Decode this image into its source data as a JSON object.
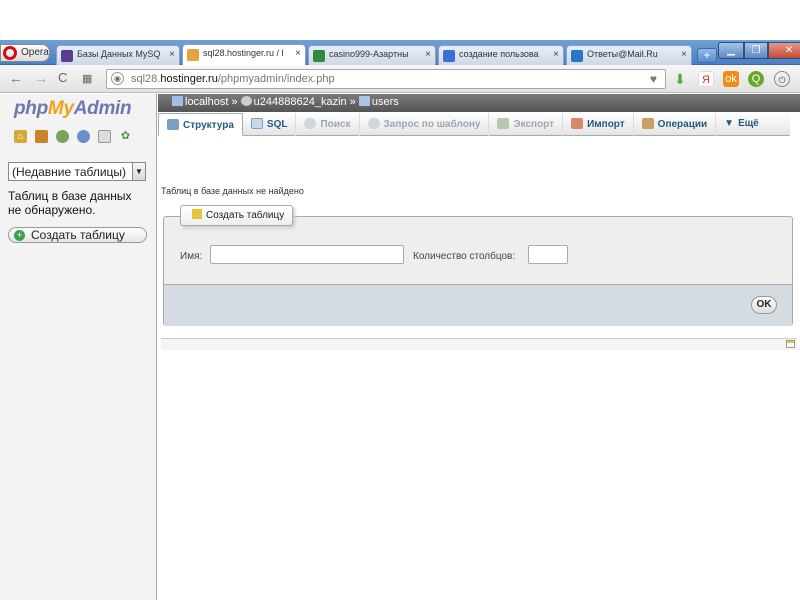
{
  "browser": {
    "opera_label": "Opera",
    "tabs": [
      {
        "label": "Базы Данных MySQ",
        "close": "×",
        "color": "#5a3e8c"
      },
      {
        "label": "sql28.hostinger.ru / l",
        "close": "×",
        "color": "#e6a23c"
      },
      {
        "label": "casino999-Азартны",
        "close": "×",
        "color": "#2f8a3a"
      },
      {
        "label": "создание пользова",
        "close": "×",
        "color": "#3b6fd4"
      },
      {
        "label": "Ответы@Mail.Ru",
        "close": "×",
        "color": "#2a76c6"
      }
    ],
    "new_tab": "+",
    "url_prefix": "sql28.",
    "url_host": "hostinger.ru",
    "url_path": "/phpmyadmin/index.php"
  },
  "sidebar": {
    "logo_php": "php",
    "logo_my": "My",
    "logo_admin": "Admin",
    "table_select_value": "(Недавние таблицы)",
    "no_tables_text": "Таблиц в базе данных не обнаружено.",
    "create_table_label": "Создать таблицу"
  },
  "breadcrumb": {
    "server": "localhost",
    "database": "u244888624_kazin",
    "table": "users",
    "sep": "»"
  },
  "menu": {
    "structure": "Структура",
    "sql": "SQL",
    "search": "Поиск",
    "query": "Запрос по шаблону",
    "export": "Экспорт",
    "import": "Импорт",
    "operations": "Операции",
    "more": "Ещё"
  },
  "content": {
    "notice": "Таблиц в базе данных не найдено",
    "legend": "Создать таблицу",
    "name_label": "Имя:",
    "columns_label": "Количество столбцов:",
    "name_value": "",
    "columns_value": "",
    "ok_label": "OK"
  }
}
